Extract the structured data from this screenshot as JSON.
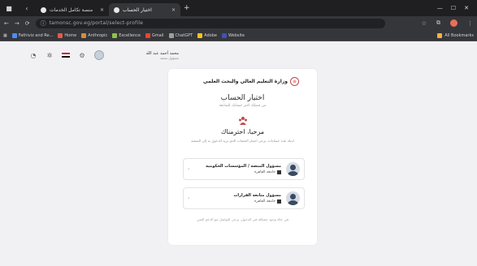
{
  "browser": {
    "tabs": [
      {
        "label": "منصة تكامل الخدمات",
        "active": false
      },
      {
        "label": "اختيار الحساب",
        "active": true
      }
    ],
    "url": "tamonsc.gov.eg/portal/select-profile",
    "bookmarks": [
      "Fathiviz and Re...",
      "Home",
      "Anthropic",
      "Excellence",
      "Gmail",
      "ChatGPT",
      "Adobe",
      "Website",
      "All Bookmarks"
    ]
  },
  "header": {
    "user_name": "محمد أحمد عبد الله",
    "user_sub": "مسؤول منصة"
  },
  "card": {
    "ministry": "وزارة التعليم العالي والبحث العلمي",
    "title": "اختيار الحساب",
    "subtitle": "من فضلك اختر حسابك للمتابعة",
    "welcome": "مرحبا، احترمناك",
    "welcome_sub": "لديك عدة حسابات، يرجى اختيار الحساب الذي تريد الدخول به إلى المنصة",
    "accounts": [
      {
        "role": "مسؤول المنصة / المؤسسات الحكومية",
        "org": "جامعة القاهرة"
      },
      {
        "role": "مسؤول متابعة القرارات",
        "org": "جامعة القاهرة"
      }
    ],
    "footer": "في حالة وجود مشكلة في الدخول، يرجى التواصل مع الدعم الفني"
  },
  "colors": {
    "flag_red": "#c8102e",
    "flag_white": "#ffffff",
    "flag_black": "#000000",
    "accent": "#c04a4a"
  }
}
